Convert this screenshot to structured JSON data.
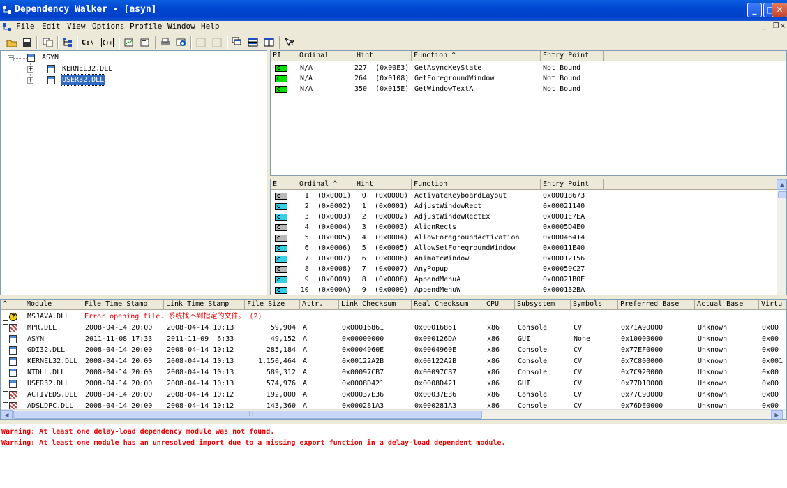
{
  "window": {
    "title": "Dependency Walker - [asyn]"
  },
  "menu": [
    "File",
    "Edit",
    "View",
    "Options",
    "Profile",
    "Window",
    "Help"
  ],
  "tree": {
    "root": "ASYN",
    "children": [
      "KERNEL32.DLL",
      "USER32.DLL"
    ]
  },
  "imports": {
    "headers": [
      "PI",
      "Ordinal",
      "Hint",
      "Function ^",
      "Entry Point"
    ],
    "rows": [
      {
        "pi": "C",
        "ord": "N/A",
        "hint": "227  (0x00E3)",
        "func": "GetAsyncKeyState",
        "entry": "Not Bound"
      },
      {
        "pi": "C",
        "ord": "N/A",
        "hint": "264  (0x0108)",
        "func": "GetForegroundWindow",
        "entry": "Not Bound"
      },
      {
        "pi": "C",
        "ord": "N/A",
        "hint": "350  (0x015E)",
        "func": "GetWindowTextA",
        "entry": "Not Bound"
      }
    ]
  },
  "exports": {
    "headers": [
      "E",
      "Ordinal ^",
      "Hint",
      "Function",
      "Entry Point"
    ],
    "rows": [
      {
        "color": "gr",
        "ord": "1  (0x0001)",
        "hint": "0  (0x0000)",
        "func": "ActivateKeyboardLayout",
        "entry": "0x00018673"
      },
      {
        "color": "c",
        "ord": "2  (0x0002)",
        "hint": "1  (0x0001)",
        "func": "AdjustWindowRect",
        "entry": "0x00021140"
      },
      {
        "color": "c",
        "ord": "3  (0x0003)",
        "hint": "2  (0x0002)",
        "func": "AdjustWindowRectEx",
        "entry": "0x0001E7EA"
      },
      {
        "color": "gr",
        "ord": "4  (0x0004)",
        "hint": "3  (0x0003)",
        "func": "AlignRects",
        "entry": "0x0005D4E0"
      },
      {
        "color": "gr",
        "ord": "5  (0x0005)",
        "hint": "4  (0x0004)",
        "func": "AllowForegroundActivation",
        "entry": "0x00046414"
      },
      {
        "color": "c",
        "ord": "6  (0x0006)",
        "hint": "5  (0x0005)",
        "func": "AllowSetForegroundWindow",
        "entry": "0x00011E40"
      },
      {
        "color": "c",
        "ord": "7  (0x0007)",
        "hint": "6  (0x0006)",
        "func": "AnimateWindow",
        "entry": "0x00012156"
      },
      {
        "color": "gr",
        "ord": "8  (0x0008)",
        "hint": "7  (0x0007)",
        "func": "AnyPopup",
        "entry": "0x00059C27"
      },
      {
        "color": "c",
        "ord": "9  (0x0009)",
        "hint": "8  (0x0008)",
        "func": "AppendMenuA",
        "entry": "0x00021B0E"
      },
      {
        "color": "c",
        "ord": "10  (0x000A)",
        "hint": "9  (0x0009)",
        "func": "AppendMenuW",
        "entry": "0x000132BA"
      }
    ]
  },
  "modules": {
    "headers": [
      "^",
      "Module",
      "File Time Stamp",
      "Link Time Stamp",
      "File Size",
      "Attr.",
      "Link Checksum",
      "Real Checksum",
      "CPU",
      "Subsystem",
      "Symbols",
      "Preferred Base",
      "Actual Base",
      "Virtu"
    ],
    "error_row": {
      "module": "MSJAVA.DLL",
      "text": "Error opening file. 系统找不到指定的文件。 (2)."
    },
    "rows": [
      {
        "flag": "x",
        "module": "MPR.DLL",
        "fts": "2008-04-14 20:00",
        "lts": "2008-04-14 10:13",
        "size": "59,904",
        "attr": "A",
        "lck": "0x00016861",
        "rck": "0x00016861",
        "cpu": "x86",
        "sub": "Console",
        "sym": "CV",
        "pb": "0x71A90000",
        "ab": "Unknown",
        "v": "0x00"
      },
      {
        "flag": "",
        "module": "ASYN",
        "fts": "2011-11-08 17:33",
        "lts": "2011-11-09  6:33",
        "size": "49,152",
        "attr": "A",
        "lck": "0x00000000",
        "rck": "0x000126DA",
        "cpu": "x86",
        "sub": "GUI",
        "sym": "None",
        "pb": "0x10000000",
        "ab": "Unknown",
        "v": "0x00"
      },
      {
        "flag": "",
        "module": "GDI32.DLL",
        "fts": "2008-04-14 20:00",
        "lts": "2008-04-14 10:12",
        "size": "285,184",
        "attr": "A",
        "lck": "0x0004960E",
        "rck": "0x0004960E",
        "cpu": "x86",
        "sub": "Console",
        "sym": "CV",
        "pb": "0x77EF0000",
        "ab": "Unknown",
        "v": "0x00"
      },
      {
        "flag": "",
        "module": "KERNEL32.DLL",
        "fts": "2008-04-14 20:00",
        "lts": "2008-04-14 10:13",
        "size": "1,150,464",
        "attr": "A",
        "lck": "0x00122A2B",
        "rck": "0x00122A2B",
        "cpu": "x86",
        "sub": "Console",
        "sym": "CV",
        "pb": "0x7C800000",
        "ab": "Unknown",
        "v": "0x001"
      },
      {
        "flag": "",
        "module": "NTDLL.DLL",
        "fts": "2008-04-14 20:00",
        "lts": "2008-04-14 10:13",
        "size": "589,312",
        "attr": "A",
        "lck": "0x00097CB7",
        "rck": "0x00097CB7",
        "cpu": "x86",
        "sub": "Console",
        "sym": "CV",
        "pb": "0x7C920000",
        "ab": "Unknown",
        "v": "0x00"
      },
      {
        "flag": "",
        "module": "USER32.DLL",
        "fts": "2008-04-14 20:00",
        "lts": "2008-04-14 10:13",
        "size": "574,976",
        "attr": "A",
        "lck": "0x0008D421",
        "rck": "0x0008D421",
        "cpu": "x86",
        "sub": "GUI",
        "sym": "CV",
        "pb": "0x77D10000",
        "ab": "Unknown",
        "v": "0x00"
      },
      {
        "flag": "x",
        "module": "ACTIVEDS.DLL",
        "fts": "2008-04-14 20:00",
        "lts": "2008-04-14 10:12",
        "size": "192,000",
        "attr": "A",
        "lck": "0x00037E36",
        "rck": "0x00037E36",
        "cpu": "x86",
        "sub": "Console",
        "sym": "CV",
        "pb": "0x77C90000",
        "ab": "Unknown",
        "v": "0x00"
      },
      {
        "flag": "x",
        "module": "ADSLDPC.DLL",
        "fts": "2008-04-14 20:00",
        "lts": "2008-04-14 10:12",
        "size": "143,360",
        "attr": "A",
        "lck": "0x000281A3",
        "rck": "0x000281A3",
        "cpu": "x86",
        "sub": "Console",
        "sym": "CV",
        "pb": "0x76DE0000",
        "ab": "Unknown",
        "v": "0x00"
      }
    ]
  },
  "log": [
    "Warning: At least one delay-load dependency module was not found.",
    "Warning: At least one module has an unresolved import due to a missing export function in a delay-load dependent module."
  ]
}
